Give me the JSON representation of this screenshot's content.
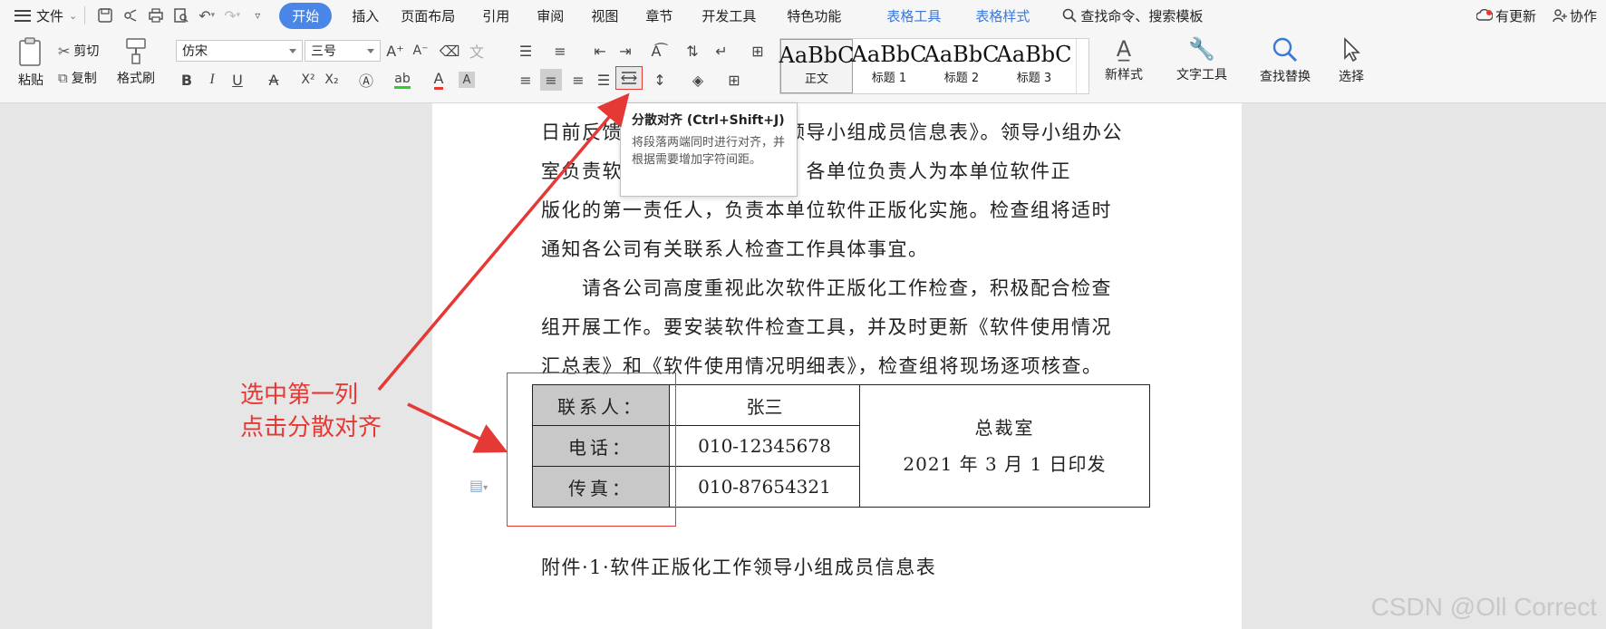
{
  "menubar": {
    "file_label": "文件",
    "tabs": [
      {
        "label": "开始",
        "active": true
      },
      {
        "label": "插入"
      },
      {
        "label": "页面布局"
      },
      {
        "label": "引用"
      },
      {
        "label": "审阅"
      },
      {
        "label": "视图"
      },
      {
        "label": "章节"
      },
      {
        "label": "开发工具"
      },
      {
        "label": "特色功能"
      },
      {
        "label": "表格工具",
        "contextual": true
      },
      {
        "label": "表格样式",
        "contextual": true
      }
    ],
    "search_label": "查找命令、搜索模板",
    "update_label": "有更新",
    "collab_label": "协作"
  },
  "ribbon": {
    "paste_label": "粘贴",
    "cut_label": "剪切",
    "copy_label": "复制",
    "format_painter_label": "格式刷",
    "font_name": "仿宋",
    "font_size": "三号",
    "styles": [
      {
        "sample": "AaBbC",
        "name": "正文"
      },
      {
        "sample": "AaBbC",
        "name": "标题 1"
      },
      {
        "sample": "AaBbC",
        "name": "标题 2"
      },
      {
        "sample": "AaBbC",
        "name": "标题 3"
      }
    ],
    "new_style_label": "新样式",
    "text_tools_label": "文字工具",
    "find_replace_label": "查找替换",
    "select_label": "选择"
  },
  "tooltip": {
    "title": "分散对齐 (Ctrl+Shift+J)",
    "description": "将段落两端同时进行对齐，并根据需要增加字符间距。"
  },
  "document": {
    "lines": [
      "日前反馈《软件正版化工作领导小组成员信息表》。领导小组办公",
      "室负责软件正版化日常工作，各单位负责人为本单位软件正",
      "版化的第一责任人，负责本单位软件正版化实施。检查组将适时",
      "通知各公司有关联系人检查工作具体事宜。",
      "　　请各公司高度重视此次软件正版化工作检查，积极配合检查",
      "组开展工作。要安装软件检查工具，并及时更新《软件使用情况",
      "汇总表》和《软件使用情况明细表》，检查组将现场逐项核查。"
    ],
    "table": {
      "rows": [
        {
          "label": "联系人：",
          "value": "张三"
        },
        {
          "label": "电话：",
          "value": "010-12345678"
        },
        {
          "label": "传真：",
          "value": "010-87654321"
        }
      ],
      "right_line1": "总裁室",
      "right_line2": "2021 年 3 月 1 日印发"
    },
    "attachment": "附件·1·软件正版化工作领导小组成员信息表"
  },
  "annotation": {
    "line1": "选中第一列",
    "line2": "点击分散对齐"
  },
  "watermark": "CSDN @Oll Correct",
  "colors": {
    "accent": "#4a86e8",
    "annotation_red": "#e53935"
  }
}
